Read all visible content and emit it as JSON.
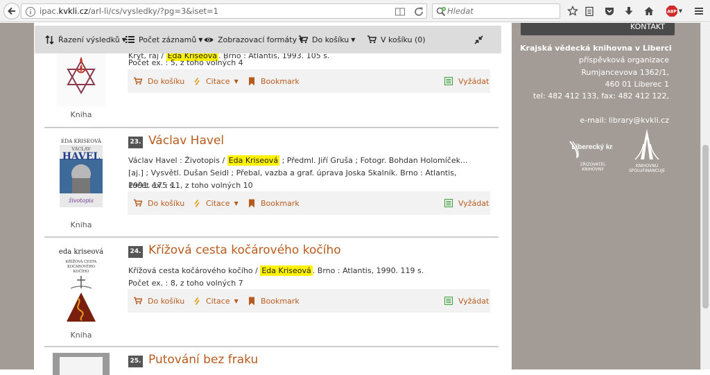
{
  "browser": {
    "url_prefix": "ipac.",
    "url_domain": "kvkli.cz",
    "url_path": "/arl-li/cs/vysledky/?pg=3&iset=1",
    "search_placeholder": "Hledat",
    "abp_label": "ABP"
  },
  "toolbar": {
    "sort_label": "Řazení výsledků",
    "count_label": "Počet záznamů",
    "formats_label": "Zobrazovací formáty",
    "to_basket_label": "Do košíku",
    "basket_label": "V košíku (0)"
  },
  "records": [
    {
      "kind": "Kniha",
      "desc_partial": "Kryt, ráj /",
      "author": "Eda Kriseová",
      "desc_partial_after": ". Brno : Atlantis, 1993. 105 s.",
      "count": "Počet ex. : 5, z toho volných 4"
    },
    {
      "number": "23.",
      "title": "Václav Havel",
      "desc_before": "Václav Havel : Životopis /",
      "author": "Eda Kriseová",
      "desc_after": "; Předml. Jiří Gruša ; Fotogr. Bohdan Holomíček... [aj.] ; Vysvětl. Dušan Seidl ; Přebal, vazba a graf. úprava Joska Skalník. Brno : Atlantis, 1991. 175 s.",
      "count": "Počet ex. : 11, z toho volných 10",
      "kind": "Kniha",
      "cover": {
        "author": "EDA KRISEOVÁ",
        "line1": "VÁCLAV",
        "line2": "HAVEL",
        "line3": "životopis"
      }
    },
    {
      "number": "24.",
      "title": "Křížová cesta kočárového kočího",
      "desc_before": "Křížová cesta kočárového kočího /",
      "author": "Eda Kriseová",
      "desc_after": ". Brno : Atlantis, 1990. 119 s.",
      "count": "Počet ex. : 8, z toho volných 7",
      "kind": "Kniha",
      "cover": {
        "author": "eda kriseová",
        "line1": "KŘÍŽOVÁ CESTA",
        "line2": "KOČÁROVÉHO",
        "line3": "KOČÍHO"
      }
    },
    {
      "number": "25.",
      "title": "Putování bez fraku"
    }
  ],
  "actions": {
    "basket": "Do košíku",
    "cite": "Citace",
    "bookmark": "Bookmark",
    "request": "Vyžádat"
  },
  "sidebar": {
    "kontakt": "KONTAKT",
    "library": "Krajská vědecká knihovna v Liberci",
    "org": "příspěvková organizace",
    "street": "Rumjancevova 1362/1,",
    "city": "460 01 Liberec 1",
    "phone": "tel: 482 412 133, fax: 482 412 122,",
    "email": "e-mail: library@kvkli.cz",
    "logo1_name": "Liberecký kraj",
    "logo1_sub": "ZŘIZOVATEL KNIHOVNY",
    "logo2_sub": "KNIHOVNU SPOLUFINANCUJE"
  },
  "colors": {
    "accent": "#b85b1e",
    "highlight": "#fff200",
    "sidebar_bg": "#a39c96",
    "toolbar_bg": "#dcdcdc"
  }
}
